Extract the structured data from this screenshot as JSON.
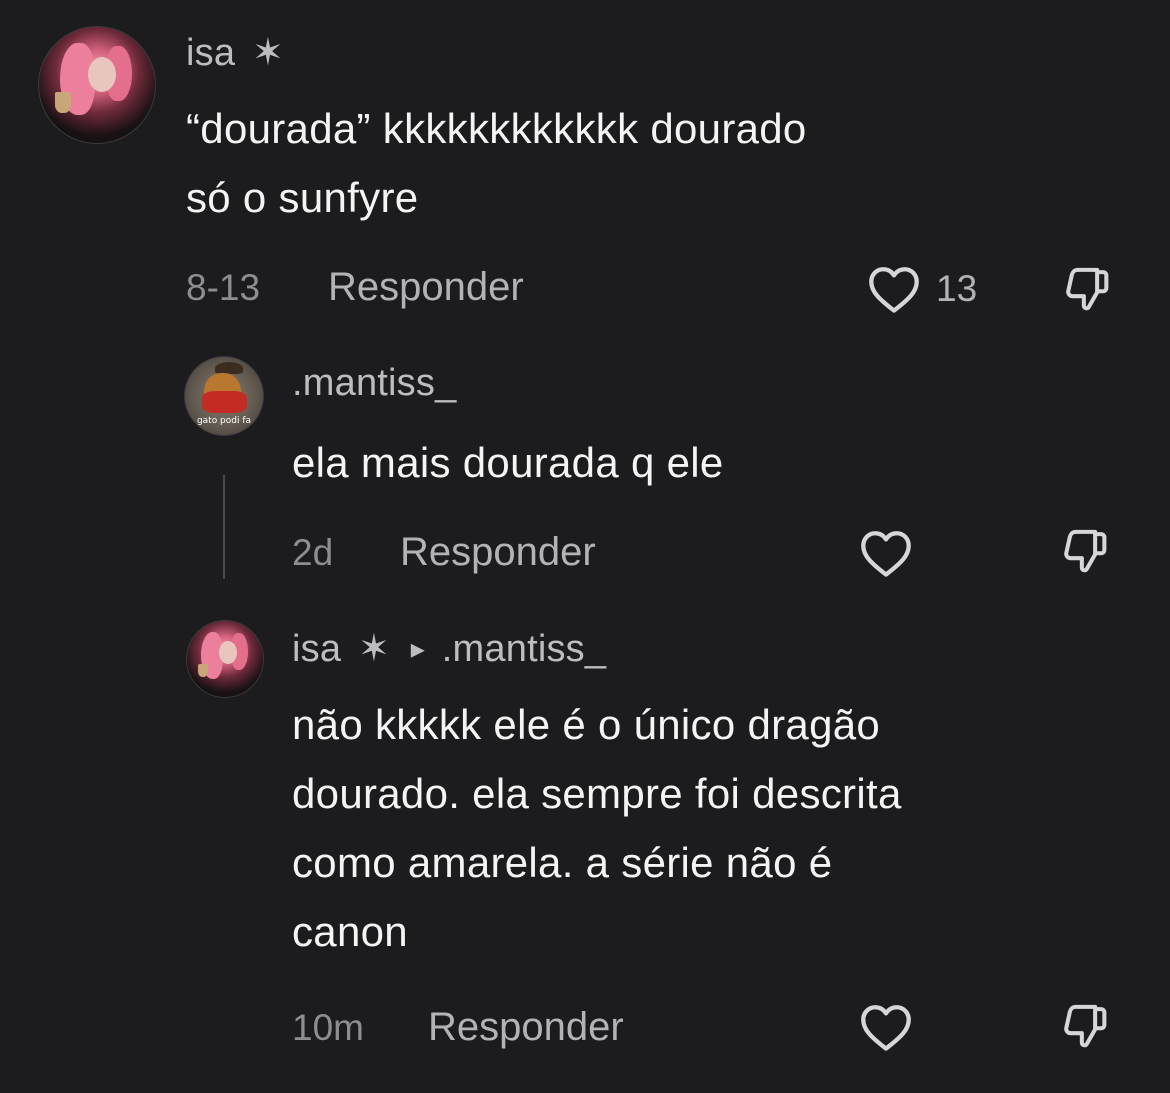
{
  "comments": [
    {
      "username": "isa",
      "badge": "✶",
      "text_lines": [
        "“dourada” kkkkkkkkkkkk dourado",
        "só o sunfyre"
      ],
      "time": "8-13",
      "reply_label": "Responder",
      "likes": "13"
    },
    {
      "username": ".mantiss_",
      "avatar_caption": "gato podi fa",
      "text_lines": [
        "ela mais dourada q ele"
      ],
      "time": "2d",
      "reply_label": "Responder"
    },
    {
      "username": "isa",
      "badge": "✶",
      "reply_arrow": "▸",
      "reply_to": ".mantiss_",
      "text_lines": [
        "não kkkkk ele é o único dragão",
        "dourado. ela sempre foi descrita",
        "como amarela. a série não é",
        "canon"
      ],
      "time": "10m",
      "reply_label": "Responder"
    }
  ],
  "colors": {
    "background": "#1c1c1e",
    "text": "#f4f4f4",
    "muted": "#8d8d92",
    "icon": "#d6d6d9"
  },
  "icons": [
    "heart-icon",
    "dislike-icon",
    "star-icon",
    "reply-arrow-icon"
  ]
}
